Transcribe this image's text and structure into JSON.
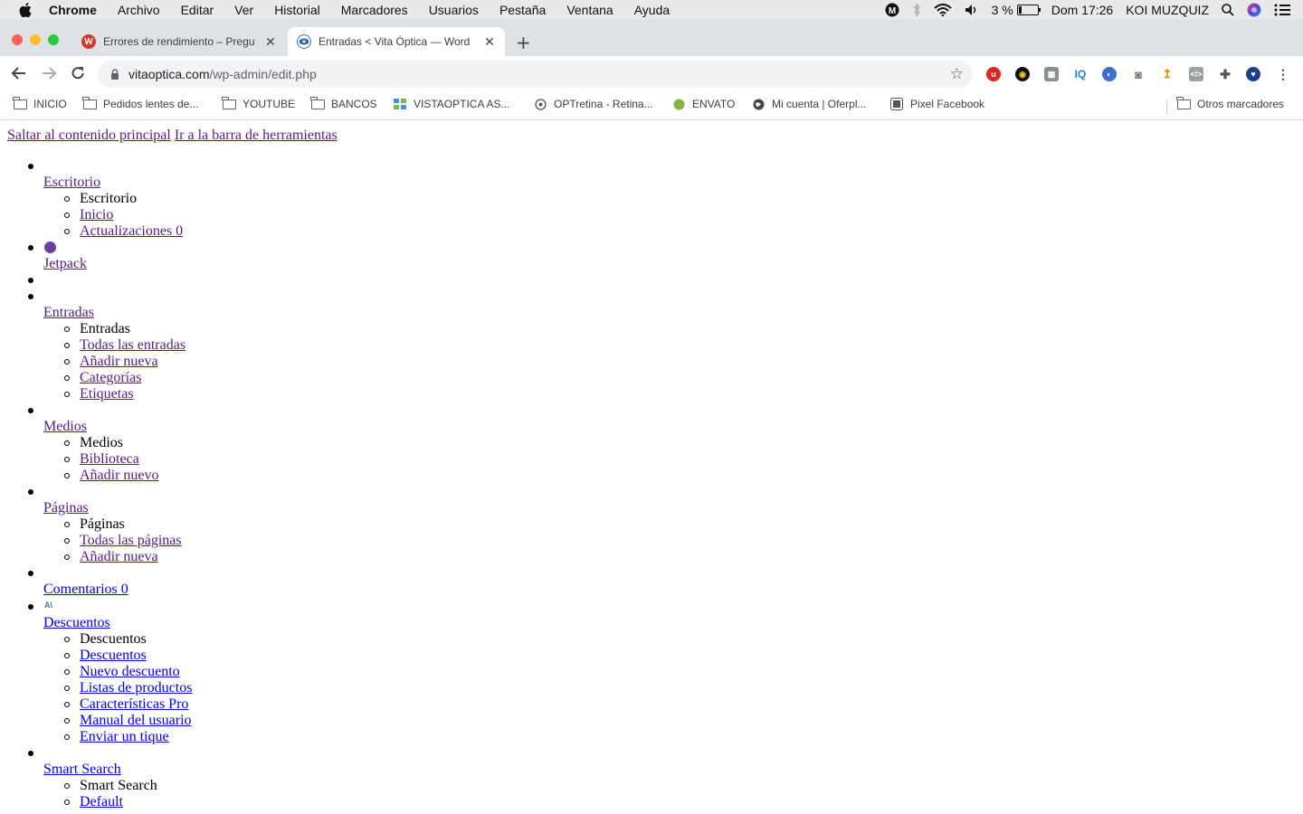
{
  "menubar": {
    "app": "Chrome",
    "items": [
      "Archivo",
      "Editar",
      "Ver",
      "Historial",
      "Marcadores",
      "Usuarios",
      "Pestaña",
      "Ventana",
      "Ayuda"
    ],
    "battery": "3 %",
    "clock": "Dom 17:26",
    "user": "KOI MUZQUIZ"
  },
  "tabs": [
    {
      "title": "Errores de rendimiento – Pregu",
      "favicon": "w-icon",
      "active": false
    },
    {
      "title": "Entradas < Vita Óptica — Word",
      "favicon": "eye-icon",
      "active": true
    }
  ],
  "toolbar": {
    "url_host": "vitaoptica.com",
    "url_path": "/wp-admin/edit.php",
    "extensions": [
      "ublock-icon",
      "coin-icon",
      "ext-grid-icon",
      "iq-icon",
      "globe-icon",
      "camera-icon",
      "arrow-icon",
      "code-icon",
      "puzzle-icon",
      "shield-icon"
    ]
  },
  "bookmarks": [
    "INICIO",
    "Pedidos lentes de...",
    "YOUTUBE",
    "BANCOS",
    "VISTAOPTICA AS...",
    "OPTretina - Retina...",
    "ENVATO",
    "Mi cuenta | Oferpl...",
    "Pixel Facebook",
    "Otros marcadores"
  ],
  "page": {
    "skip_content": "Saltar al contenido principal",
    "skip_toolbar": "Ir a la barra de herramientas",
    "escritorio": {
      "label": "Escritorio",
      "header": "Escritorio",
      "links": [
        "Inicio",
        "Actualizaciones 0"
      ]
    },
    "jetpack": {
      "label": "Jetpack"
    },
    "entradas": {
      "label": "Entradas",
      "header": "Entradas",
      "links": [
        "Todas las entradas",
        "Añadir nueva",
        "Categorías",
        "Etiquetas"
      ]
    },
    "medios": {
      "label": "Medios",
      "header": "Medios",
      "links": [
        "Biblioteca",
        "Añadir nuevo"
      ]
    },
    "paginas": {
      "label": "Páginas",
      "header": "Páginas",
      "links": [
        "Todas las páginas",
        "Añadir nueva"
      ]
    },
    "comentarios": {
      "label": "Comentarios 0"
    },
    "descuentos": {
      "label": "Descuentos",
      "header": "Descuentos",
      "links": [
        "Descuentos",
        "Nuevo descuento",
        "Listas de productos",
        "Características Pro",
        "Manual del usuario",
        "Enviar un tique"
      ]
    },
    "smart_search": {
      "label": "Smart Search",
      "header": "Smart Search",
      "links": [
        "Default"
      ]
    }
  }
}
